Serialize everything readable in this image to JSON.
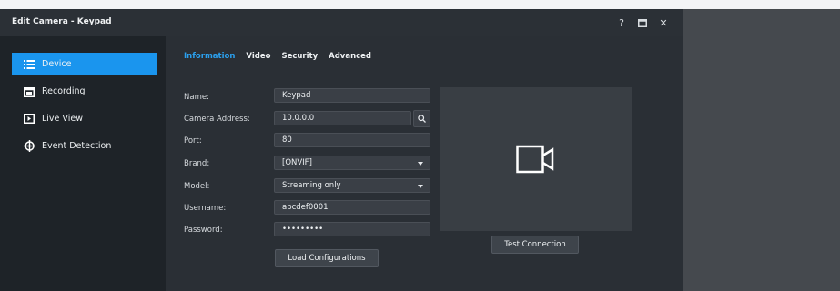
{
  "window": {
    "title": "Edit Camera - Keypad",
    "controls": [
      "help-icon",
      "maximize-icon",
      "close-icon"
    ],
    "help_label": "?",
    "close_label": "✕"
  },
  "sidebar": {
    "items": [
      {
        "label": "Device",
        "icon": "list-icon",
        "active": true
      },
      {
        "label": "Recording",
        "icon": "calendar-icon",
        "active": false
      },
      {
        "label": "Live View",
        "icon": "live-view-icon",
        "active": false
      },
      {
        "label": "Event Detection",
        "icon": "crosshair-icon",
        "active": false
      }
    ]
  },
  "tabs": [
    {
      "label": "Information",
      "active": true
    },
    {
      "label": "Video",
      "active": false
    },
    {
      "label": "Security",
      "active": false
    },
    {
      "label": "Advanced",
      "active": false
    }
  ],
  "form": {
    "name": {
      "label": "Name:",
      "value": "Keypad"
    },
    "address": {
      "label": "Camera Address:",
      "value": "10.0.0.0"
    },
    "port": {
      "label": "Port:",
      "value": "80"
    },
    "brand": {
      "label": "Brand:",
      "value": "[ONVIF]"
    },
    "model": {
      "label": "Model:",
      "value": "Streaming only"
    },
    "username": {
      "label": "Username:",
      "value": "abcdef0001"
    },
    "password": {
      "label": "Password:",
      "value": "•••••••••"
    }
  },
  "buttons": {
    "load": "Load Configurations",
    "test": "Test Connection"
  },
  "colors": {
    "accent": "#1a95ee",
    "active_tab": "#2ba0ee",
    "window_bg": "#22272d"
  }
}
